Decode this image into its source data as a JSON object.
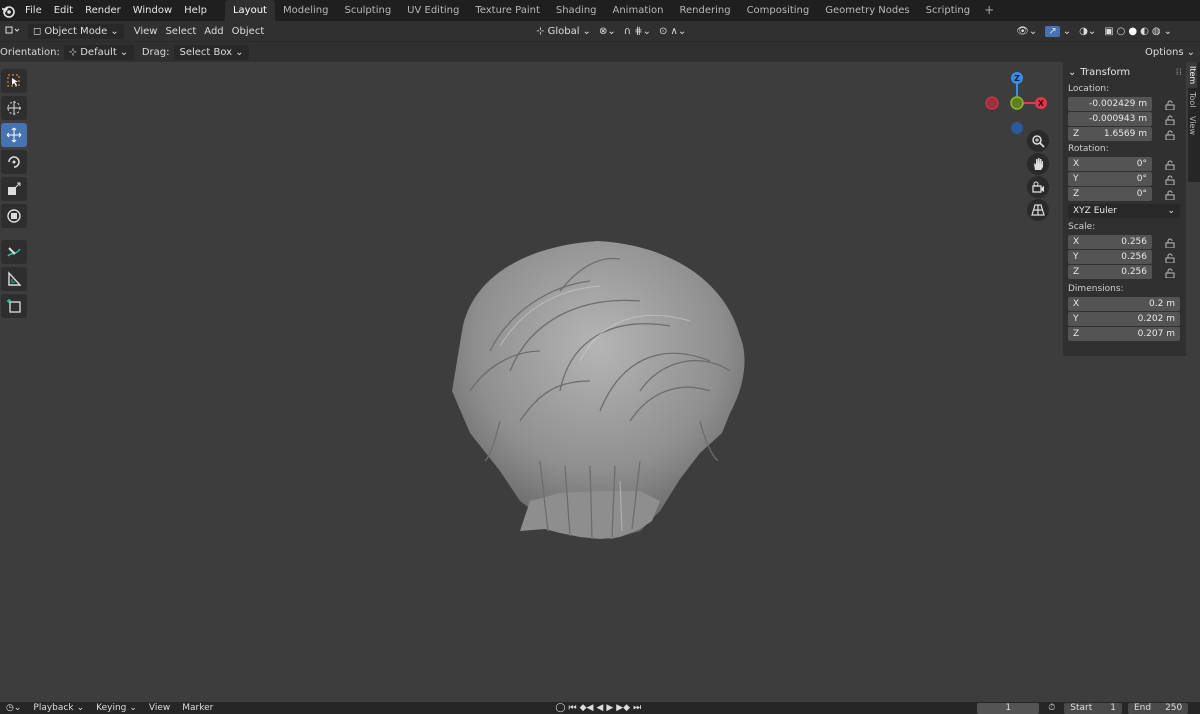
{
  "menu": {
    "items": [
      "File",
      "Edit",
      "Render",
      "Window",
      "Help"
    ]
  },
  "workspace_tabs": [
    {
      "label": "Layout",
      "active": true
    },
    {
      "label": "Modeling"
    },
    {
      "label": "Sculpting"
    },
    {
      "label": "UV Editing"
    },
    {
      "label": "Texture Paint"
    },
    {
      "label": "Shading"
    },
    {
      "label": "Animation"
    },
    {
      "label": "Rendering"
    },
    {
      "label": "Compositing"
    },
    {
      "label": "Geometry Nodes"
    },
    {
      "label": "Scripting"
    }
  ],
  "header": {
    "mode": "Object Mode",
    "view": "View",
    "select": "Select",
    "add": "Add",
    "object": "Object",
    "transform_orientation": "Global"
  },
  "tool_header": {
    "orientation_label": "Orientation:",
    "orientation_value": "Default",
    "drag_label": "Drag:",
    "drag_value": "Select Box",
    "options": "Options"
  },
  "sidebar": {
    "tabs": [
      "Item",
      "Tool",
      "View"
    ],
    "panel_title": "Transform",
    "location_label": "Location:",
    "location": [
      {
        "axis": "",
        "value": "-0.002429 m"
      },
      {
        "axis": "",
        "value": "-0.000943 m"
      },
      {
        "axis": "Z",
        "value": "1.6569 m"
      }
    ],
    "rotation_label": "Rotation:",
    "rotation": [
      {
        "axis": "X",
        "value": "0°"
      },
      {
        "axis": "Y",
        "value": "0°"
      },
      {
        "axis": "Z",
        "value": "0°"
      }
    ],
    "rotation_mode": "XYZ Euler",
    "scale_label": "Scale:",
    "scale": [
      {
        "axis": "X",
        "value": "0.256"
      },
      {
        "axis": "Y",
        "value": "0.256"
      },
      {
        "axis": "Z",
        "value": "0.256"
      }
    ],
    "dimensions_label": "Dimensions:",
    "dimensions": [
      {
        "axis": "X",
        "value": "0.2 m"
      },
      {
        "axis": "Y",
        "value": "0.202 m"
      },
      {
        "axis": "Z",
        "value": "0.207 m"
      }
    ]
  },
  "gizmo": {
    "x": "X",
    "z": "Z"
  },
  "timeline": {
    "playback": "Playback",
    "keying": "Keying",
    "view": "View",
    "marker": "Marker",
    "current_frame": "1",
    "start_label": "Start",
    "start_value": "1",
    "end_label": "End",
    "end_value": "250"
  },
  "colors": {
    "accent": "#4772b3",
    "axis_x": "#e8354a",
    "axis_y": "#8cbc2a",
    "axis_z": "#3b8ee5",
    "viewport_bg": "#3d3d3d"
  }
}
